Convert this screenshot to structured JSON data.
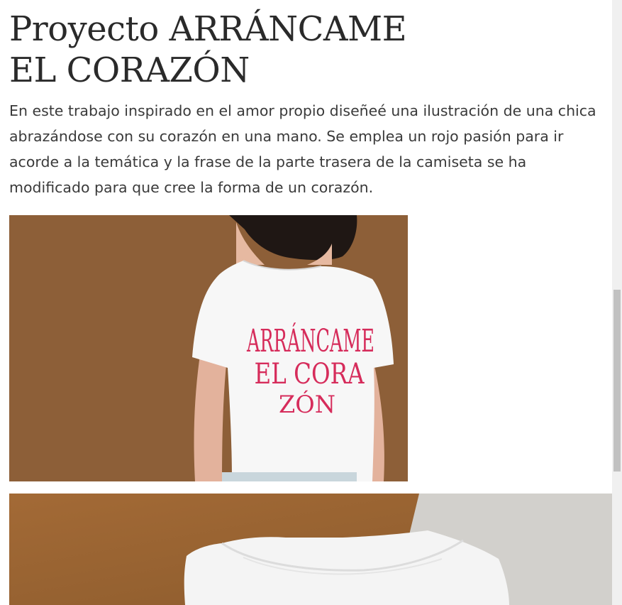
{
  "article": {
    "title": "Proyecto ARRÁNCAME EL CORAZÓN",
    "description": "En este trabajo inspirado en el amor propio diseñeé una ilustración de una chica abrazándose con su corazón en una mano. Se emplea un rojo pasión para ir acorde a la temática y la frase de la parte trasera de la camiseta se ha modificado para que cree la forma de un corazón."
  },
  "shirt_print": {
    "line1": "ARRÁNCAME",
    "line2": "EL CORA",
    "line3": "ZÓN"
  },
  "colors": {
    "photo1_background": "#8d5f38",
    "print_red": "#d62c5b"
  }
}
